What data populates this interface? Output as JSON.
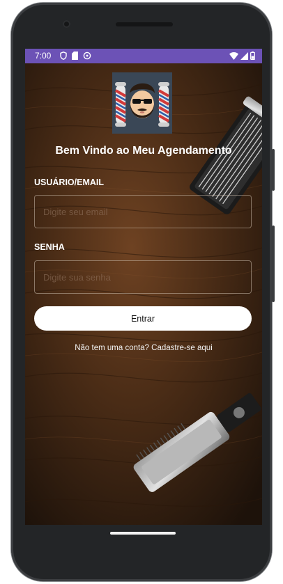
{
  "status_bar": {
    "time": "7:00",
    "left_icons": [
      "shield-icon",
      "sd-card-icon",
      "sync-icon"
    ],
    "right_icons": [
      "wifi-icon",
      "signal-icon",
      "battery-icon"
    ],
    "color": "#6c52b6"
  },
  "app": {
    "logo": "barber-logo",
    "welcome_title": "Bem Vindo ao Meu Agendamento"
  },
  "form": {
    "user_label": "USUÁRIO/EMAIL",
    "user_placeholder": "Digite seu email",
    "password_label": "SENHA",
    "password_placeholder": "Digite sua senha",
    "submit_label": "Entrar",
    "signup_text": "Não tem uma conta? Cadastre-se aqui"
  },
  "nav": {
    "home_indicator": "gesture-bar"
  }
}
